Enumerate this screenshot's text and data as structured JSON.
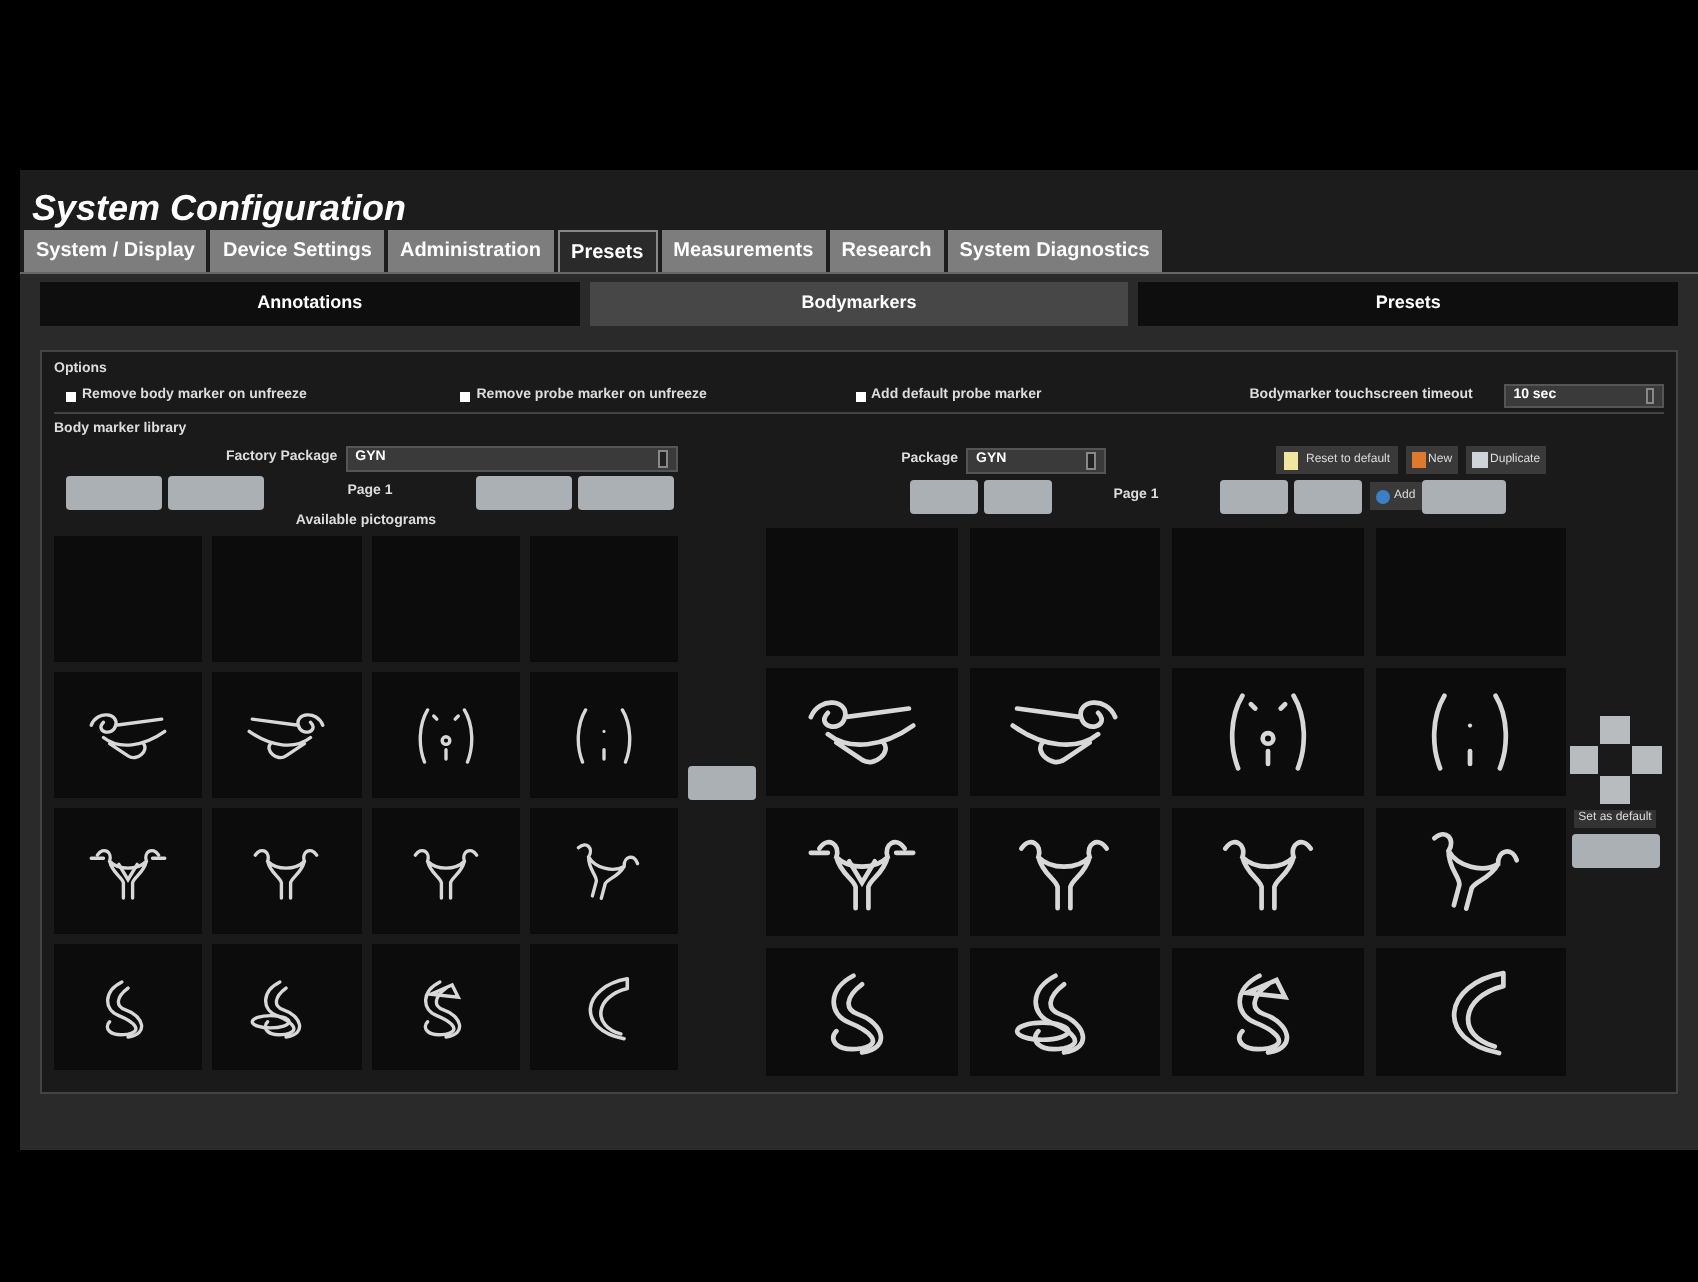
{
  "window": {
    "title": "System Configuration"
  },
  "tabs": [
    {
      "label": "System / Display",
      "selected": false
    },
    {
      "label": "Device Settings",
      "selected": false
    },
    {
      "label": "Administration",
      "selected": false
    },
    {
      "label": "Presets",
      "selected": true
    },
    {
      "label": "Measurements",
      "selected": false
    },
    {
      "label": "Research",
      "selected": false
    },
    {
      "label": "System Diagnostics",
      "selected": false
    }
  ],
  "subtabs": [
    {
      "label": "Annotations",
      "selected": false
    },
    {
      "label": "Bodymarkers",
      "selected": true
    },
    {
      "label": "Presets",
      "selected": false
    }
  ],
  "options": {
    "title": "Options",
    "checkboxes": [
      {
        "label": "Remove body marker on unfreeze",
        "checked": true
      },
      {
        "label": "Remove probe marker on unfreeze",
        "checked": true
      },
      {
        "label": "Add default probe marker",
        "checked": true
      }
    ],
    "timeout": {
      "label": "Bodymarker touchscreen timeout",
      "value": "10 sec"
    }
  },
  "library": {
    "title": "Body marker library",
    "left": {
      "package_label": "Factory Package",
      "package_value": "GYN",
      "page": "Page 1",
      "caption": "Available pictograms",
      "pictograms": [
        {
          "kind": "empty"
        },
        {
          "kind": "empty"
        },
        {
          "kind": "empty"
        },
        {
          "kind": "empty"
        },
        {
          "kind": "tube-left"
        },
        {
          "kind": "tube-right"
        },
        {
          "kind": "torso-navel"
        },
        {
          "kind": "torso"
        },
        {
          "kind": "uterus-detailed"
        },
        {
          "kind": "uterus"
        },
        {
          "kind": "uterus"
        },
        {
          "kind": "uterus-tilted"
        },
        {
          "kind": "curl"
        },
        {
          "kind": "curl-ring"
        },
        {
          "kind": "curl-probe"
        },
        {
          "kind": "crescent"
        }
      ]
    },
    "right": {
      "package_label": "Package",
      "package_value": "GYN",
      "page": "Page 1",
      "reset": "Reset to default",
      "new": "New",
      "duplicate": "Duplicate",
      "add": "Add",
      "pictograms": [
        {
          "kind": "empty"
        },
        {
          "kind": "empty"
        },
        {
          "kind": "empty"
        },
        {
          "kind": "empty"
        },
        {
          "kind": "tube-left"
        },
        {
          "kind": "tube-right"
        },
        {
          "kind": "torso-navel"
        },
        {
          "kind": "torso"
        },
        {
          "kind": "uterus-detailed"
        },
        {
          "kind": "uterus"
        },
        {
          "kind": "uterus"
        },
        {
          "kind": "uterus-tilted"
        },
        {
          "kind": "curl"
        },
        {
          "kind": "curl-ring"
        },
        {
          "kind": "curl-probe"
        },
        {
          "kind": "crescent"
        }
      ]
    },
    "set_default": "Set as default"
  }
}
